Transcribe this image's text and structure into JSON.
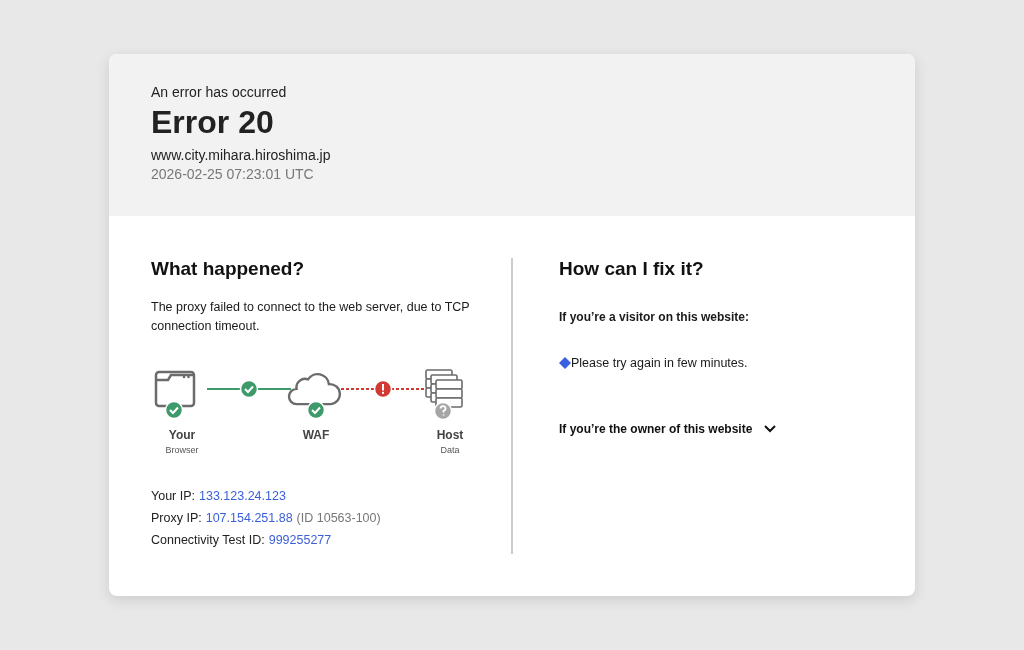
{
  "header": {
    "eyebrow": "An error has occurred",
    "title": "Error 20",
    "host": "www.city.mihara.hiroshima.jp",
    "timestamp": "2026-02-25 07:23:01 UTC"
  },
  "what_happened": {
    "heading": "What happened?",
    "description": "The proxy failed to connect to the web server, due to TCP connection timeout.",
    "nodes": [
      {
        "kind": "browser",
        "verified": true,
        "label": "Your",
        "sublabel": "Browser"
      },
      {
        "kind": "cloud",
        "verified": true,
        "label": "WAF"
      },
      {
        "kind": "server",
        "verified": false,
        "label": "Host",
        "sublabel": "Data"
      }
    ],
    "links": [
      {
        "connected": true
      },
      {
        "connected": false
      }
    ],
    "details": [
      {
        "label": "Your IP:",
        "value": "133.123.24.123"
      },
      {
        "label": "Proxy IP:",
        "value": "107.154.251.88",
        "note": "(ID 10563-100)"
      },
      {
        "label": "Connectivity Test ID:",
        "value": "999255277"
      }
    ]
  },
  "how_to_fix": {
    "heading": "How can I fix it?",
    "visitor_heading": "If you’re a visitor on this website:",
    "visitor_tips": [
      "Please try again in few minutes."
    ],
    "owner_section": {
      "label": "If you’re the owner of this website",
      "expanded": false
    }
  }
}
